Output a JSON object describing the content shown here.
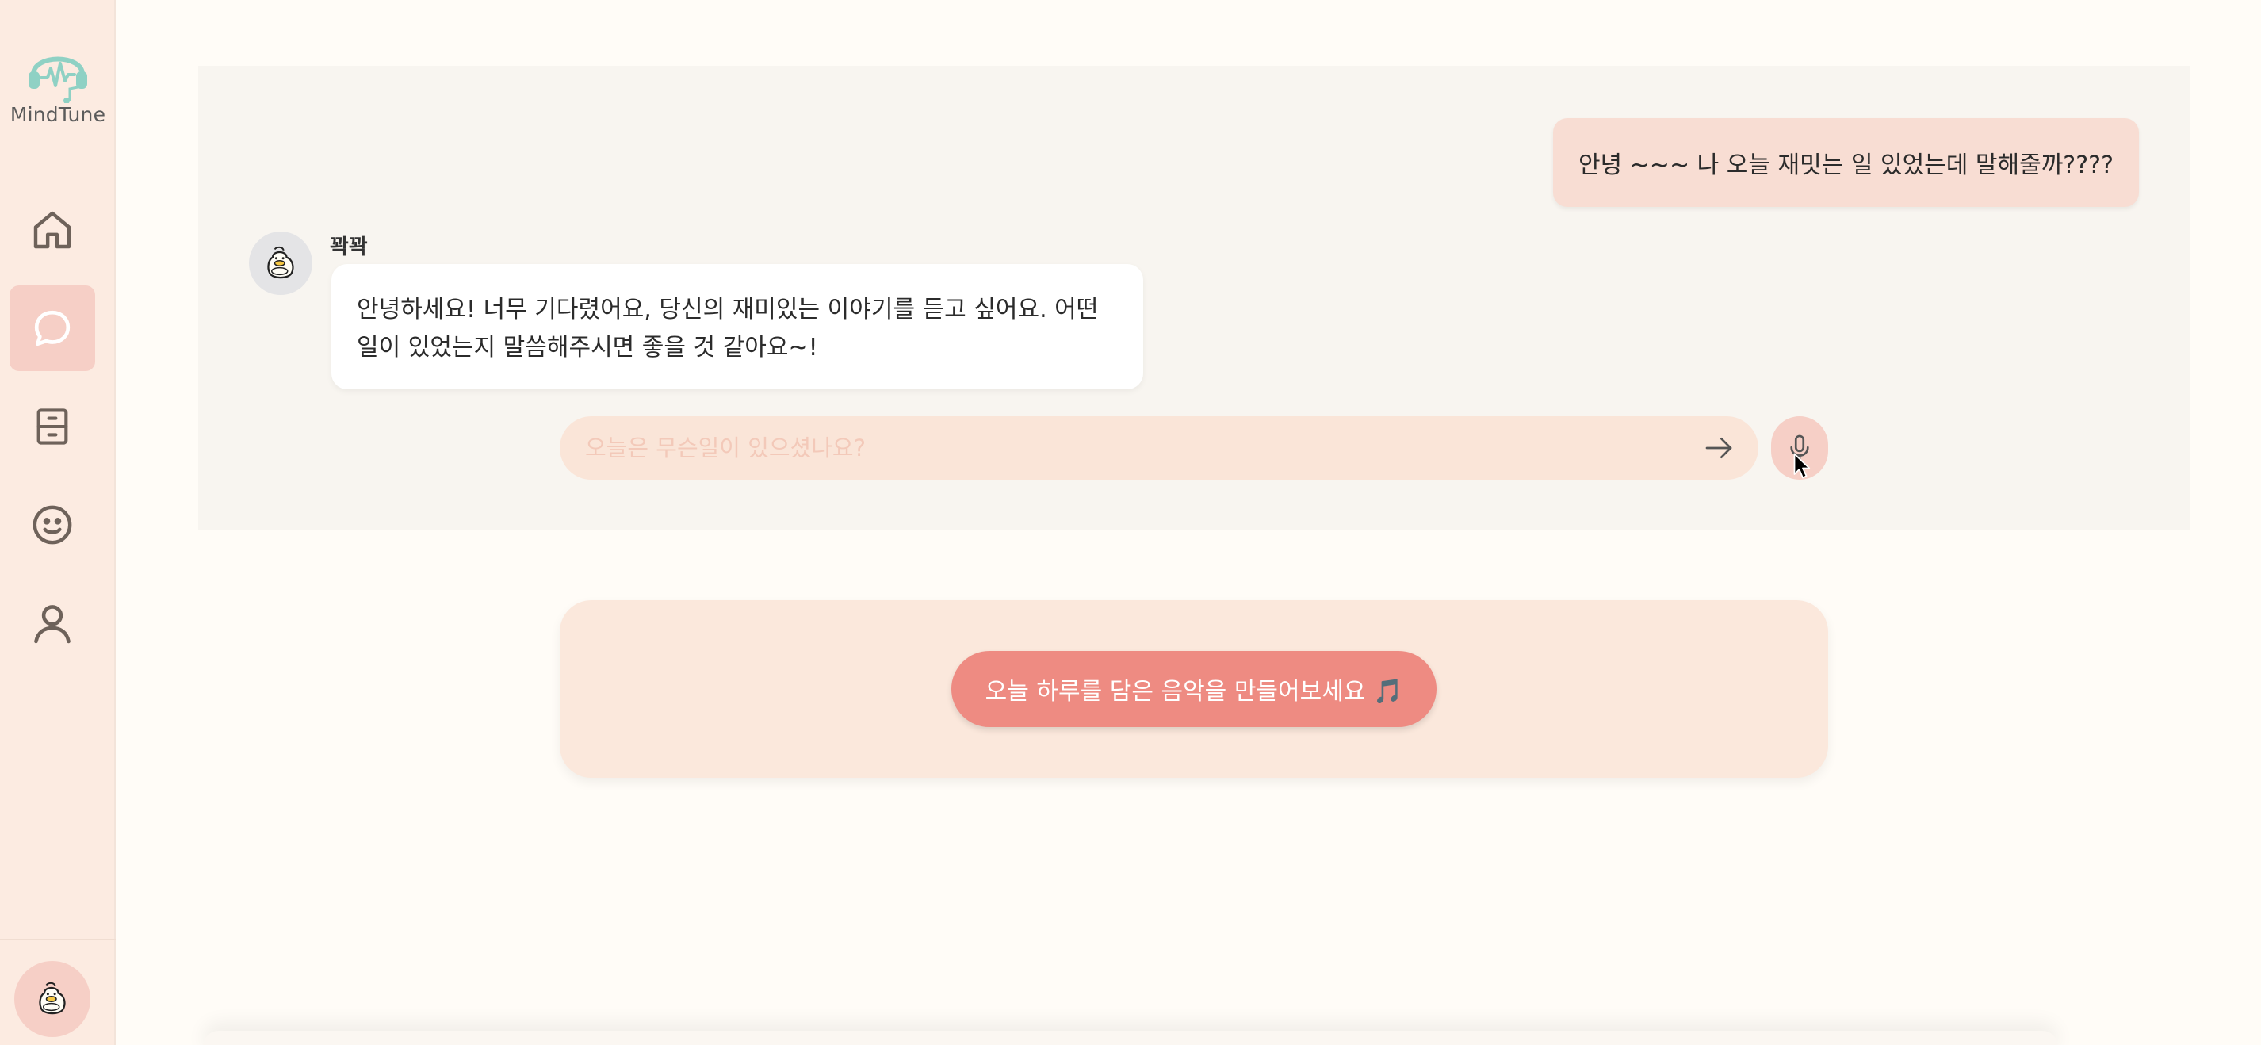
{
  "app": {
    "name": "MindTune",
    "accent_color": "#ee8b82",
    "sidebar_color": "#fcebe1"
  },
  "sidebar": {
    "items": [
      {
        "icon": "home-icon",
        "active": false
      },
      {
        "icon": "chat-icon",
        "active": true
      },
      {
        "icon": "archive-icon",
        "active": false
      },
      {
        "icon": "smiley-icon",
        "active": false
      },
      {
        "icon": "user-icon",
        "active": false
      }
    ],
    "profile_icon": "duck-avatar-icon"
  },
  "chat": {
    "messages": [
      {
        "sender": "user",
        "text": "안녕 ~~~ 나 오늘 재밋는 일 있었는데 말해줄까????"
      },
      {
        "sender": "bot",
        "name": "꽉꽉",
        "line1": "안녕하세요! 너무 기다렸어요, 당신의 재미있는 이야기를 듣고 싶어요. 어떤",
        "line2": "일이 있었는지 말씀해주시면 좋을 것 같아요~!"
      }
    ],
    "input": {
      "placeholder": "오늘은 무슨일이 있으셨나요?",
      "value": ""
    }
  },
  "music_card": {
    "button_label": "오늘 하루를 담은 음악을 만들어보세요 🎵"
  }
}
